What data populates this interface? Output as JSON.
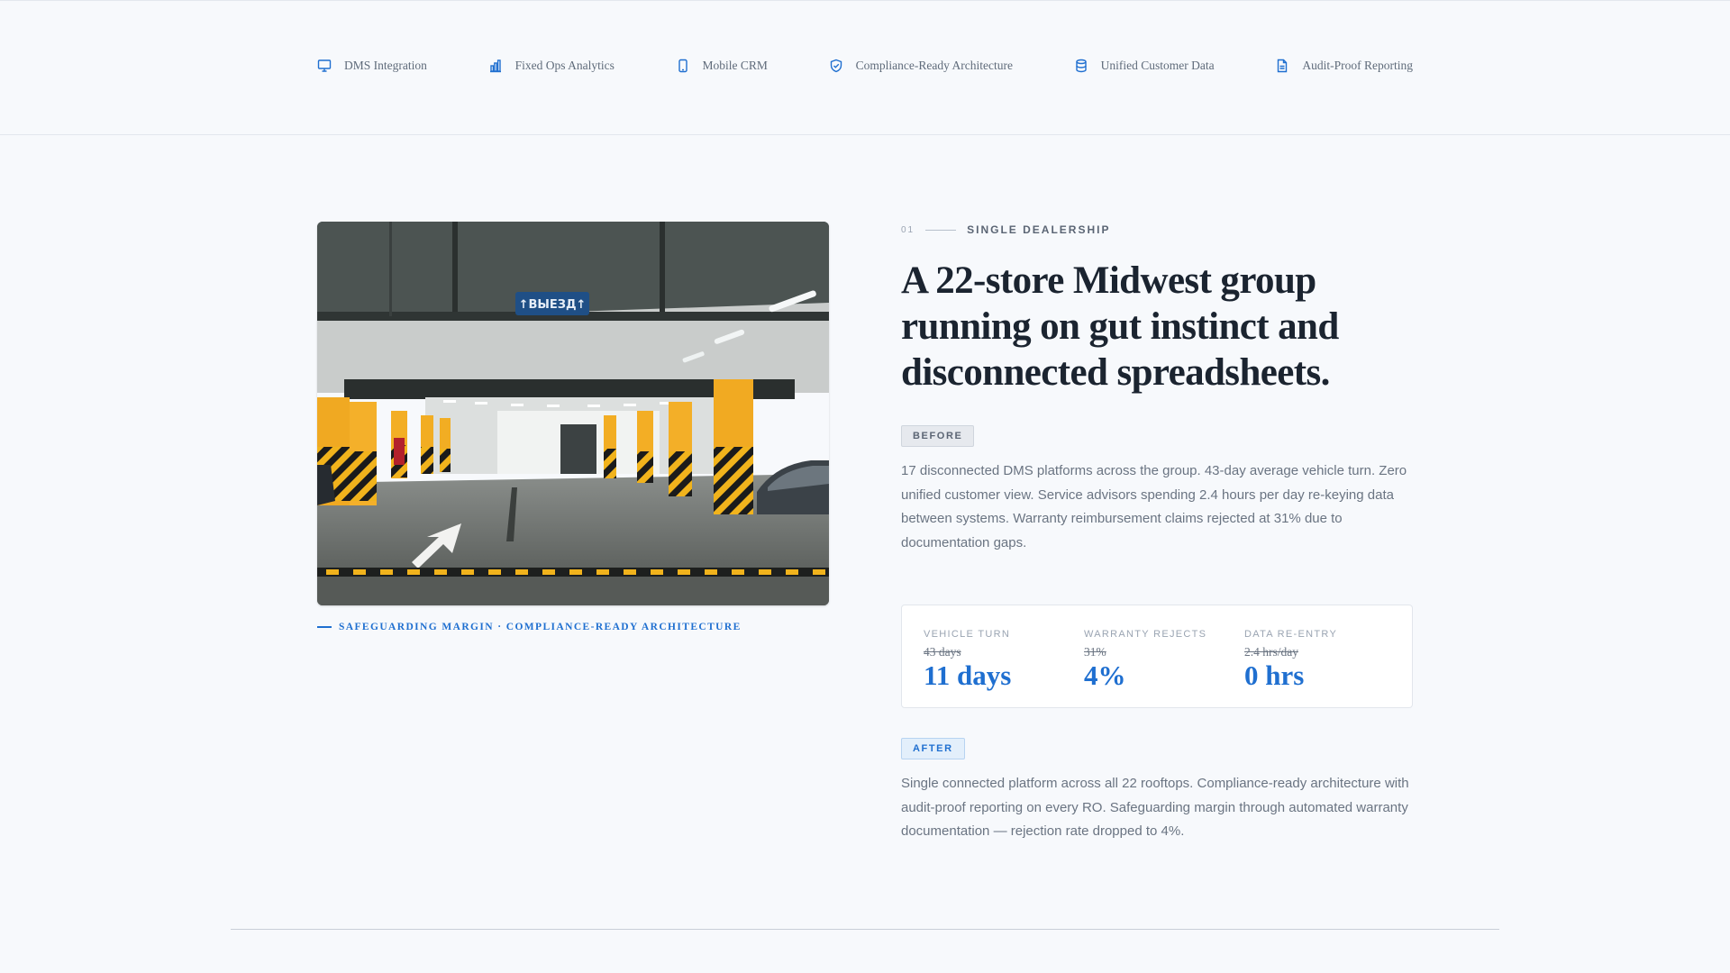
{
  "colors": {
    "accent": "#1f6fd0",
    "background": "#f7f9fc",
    "heading": "#1b2430",
    "muted": "#6a7482"
  },
  "features": [
    {
      "label": "DMS Integration",
      "icon": "monitor-icon"
    },
    {
      "label": "Fixed Ops Analytics",
      "icon": "bar-chart-icon"
    },
    {
      "label": "Mobile CRM",
      "icon": "smartphone-icon"
    },
    {
      "label": "Compliance-Ready Architecture",
      "icon": "shield-check-icon"
    },
    {
      "label": "Unified Customer Data",
      "icon": "database-icon"
    },
    {
      "label": "Audit-Proof Reporting",
      "icon": "file-text-icon"
    }
  ],
  "photo": {
    "sign_text": "↑ВЫЕЗД↑"
  },
  "caption": "SAFEGUARDING MARGIN · COMPLIANCE-READY ARCHITECTURE",
  "case": {
    "number": "01",
    "category": "SINGLE DEALERSHIP",
    "headline": "A 22-store Midwest group running on gut instinct and disconnected spreadsheets.",
    "before_tag": "BEFORE",
    "before_text": "17 disconnected DMS platforms across the group. 43-day average vehicle turn. Zero unified customer view. Service advisors spending 2.4 hours per day re-keying data between systems. Warranty reimbursement claims rejected at 31% due to documentation gaps.",
    "metrics": [
      {
        "label": "VEHICLE TURN",
        "before": "43 days",
        "after": "11 days"
      },
      {
        "label": "WARRANTY REJECTS",
        "before": "31%",
        "after": "4%"
      },
      {
        "label": "DATA RE-ENTRY",
        "before": "2.4 hrs/day",
        "after": "0 hrs"
      }
    ],
    "after_tag": "AFTER",
    "after_text": "Single connected platform across all 22 rooftops. Compliance-ready architecture with audit-proof reporting on every RO. Safeguarding margin through automated warranty documentation — rejection rate dropped to 4%."
  }
}
